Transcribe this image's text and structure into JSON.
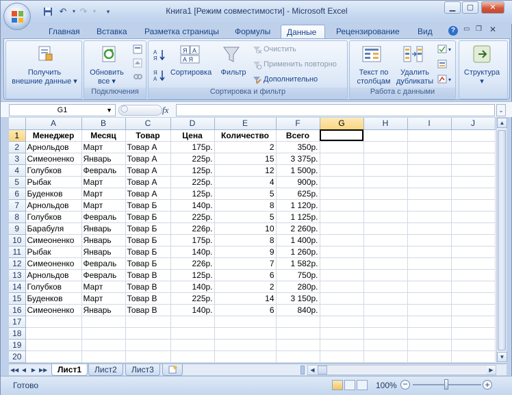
{
  "title": "Книга1  [Режим совместимости] - Microsoft Excel",
  "ribbon_tabs": [
    "Главная",
    "Вставка",
    "Разметка страницы",
    "Формулы",
    "Данные",
    "Рецензирование",
    "Вид"
  ],
  "active_tab": "Данные",
  "groups": {
    "external": {
      "label1": "Получить",
      "label2": "внешние данные"
    },
    "connections": {
      "refresh1": "Обновить",
      "refresh2": "все",
      "caption": "Подключения"
    },
    "sortfilter": {
      "sort": "Сортировка",
      "filter": "Фильтр",
      "clear": "Очистить",
      "reapply": "Применить повторно",
      "advanced": "Дополнительно",
      "caption": "Сортировка и фильтр"
    },
    "datatools": {
      "text1": "Текст по",
      "text2": "столбцам",
      "dup1": "Удалить",
      "dup2": "дубликаты",
      "caption": "Работа с данными"
    },
    "outline": {
      "label": "Структура"
    }
  },
  "namebox": "G1",
  "fx_label": "fx",
  "columns": [
    "A",
    "B",
    "C",
    "D",
    "E",
    "F",
    "G",
    "H",
    "I",
    "J"
  ],
  "rows": [
    [
      "1",
      "Менеджер",
      "Месяц",
      "Товар",
      "Цена",
      "Количество",
      "Всего"
    ],
    [
      "2",
      "Арнольдов",
      "Март",
      "Товар А",
      "175р.",
      "2",
      "350р."
    ],
    [
      "3",
      "Симеоненко",
      "Январь",
      "Товар А",
      "225р.",
      "15",
      "3 375р."
    ],
    [
      "4",
      "Голубков",
      "Февраль",
      "Товар А",
      "125р.",
      "12",
      "1 500р."
    ],
    [
      "5",
      "Рыбак",
      "Март",
      "Товар А",
      "225р.",
      "4",
      "900р."
    ],
    [
      "6",
      "Буденков",
      "Март",
      "Товар А",
      "125р.",
      "5",
      "625р."
    ],
    [
      "7",
      "Арнольдов",
      "Март",
      "Товар Б",
      "140р.",
      "8",
      "1 120р."
    ],
    [
      "8",
      "Голубков",
      "Февраль",
      "Товар Б",
      "225р.",
      "5",
      "1 125р."
    ],
    [
      "9",
      "Барабуля",
      "Январь",
      "Товар Б",
      "226р.",
      "10",
      "2 260р."
    ],
    [
      "10",
      "Симеоненко",
      "Январь",
      "Товар Б",
      "175р.",
      "8",
      "1 400р."
    ],
    [
      "11",
      "Рыбак",
      "Январь",
      "Товар Б",
      "140р.",
      "9",
      "1 260р."
    ],
    [
      "12",
      "Симеоненко",
      "Февраль",
      "Товар Б",
      "226р.",
      "7",
      "1 582р."
    ],
    [
      "13",
      "Арнольдов",
      "Февраль",
      "Товар В",
      "125р.",
      "6",
      "750р."
    ],
    [
      "14",
      "Голубков",
      "Март",
      "Товар В",
      "140р.",
      "2",
      "280р."
    ],
    [
      "15",
      "Буденков",
      "Март",
      "Товар В",
      "225р.",
      "14",
      "3 150р."
    ],
    [
      "16",
      "Симеоненко",
      "Январь",
      "Товар В",
      "140р.",
      "6",
      "840р."
    ],
    [
      "17"
    ],
    [
      "18"
    ],
    [
      "19"
    ],
    [
      "20"
    ]
  ],
  "sheets": [
    "Лист1",
    "Лист2",
    "Лист3"
  ],
  "active_sheet": "Лист1",
  "status": "Готово",
  "zoom": "100%"
}
